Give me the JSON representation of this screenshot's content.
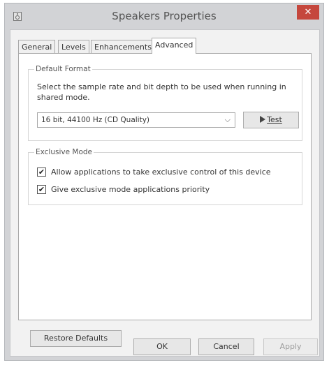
{
  "window": {
    "title": "Speakers Properties",
    "close_glyph": "✕"
  },
  "tabs": [
    {
      "label": "General",
      "active": false
    },
    {
      "label": "Levels",
      "active": false
    },
    {
      "label": "Enhancements",
      "active": false
    },
    {
      "label": "Advanced",
      "active": true
    }
  ],
  "default_format": {
    "legend": "Default Format",
    "description": "Select the sample rate and bit depth to be used when running in shared mode.",
    "selected": "16 bit, 44100 Hz (CD Quality)",
    "test_button": "Test"
  },
  "exclusive_mode": {
    "legend": "Exclusive Mode",
    "options": [
      {
        "label": "Allow applications to take exclusive control of this device",
        "checked": true
      },
      {
        "label": "Give exclusive mode applications priority",
        "checked": true
      }
    ]
  },
  "buttons": {
    "restore_defaults": "Restore Defaults",
    "ok": "OK",
    "cancel": "Cancel",
    "apply": "Apply"
  },
  "icons": {
    "window": "speaker-icon",
    "close": "close-icon",
    "dropdown": "chevron-down-icon",
    "test": "play-icon",
    "checkbox": "checkmark-icon"
  }
}
